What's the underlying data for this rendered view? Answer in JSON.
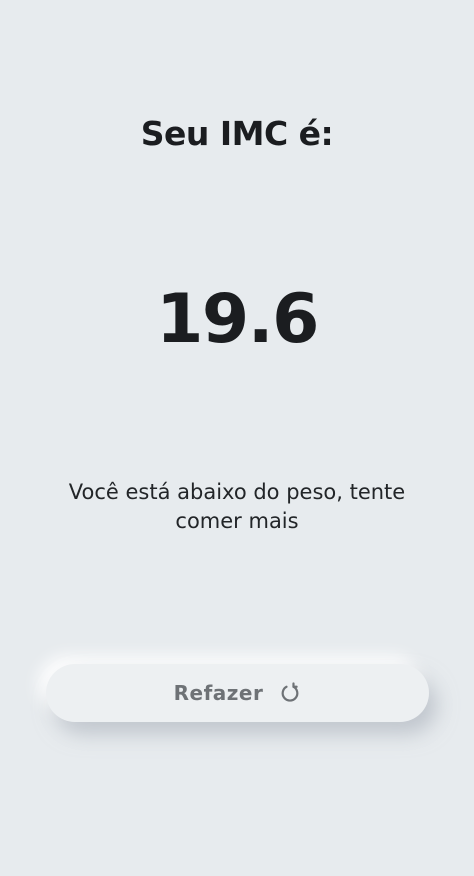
{
  "result": {
    "title": "Seu IMC é:",
    "value": "19.6",
    "message": "Você está abaixo do peso, tente comer mais"
  },
  "actions": {
    "redo_label": "Refazer",
    "redo_icon": "refresh-icon"
  },
  "colors": {
    "background": "#e7ebee",
    "button_background": "#edf0f2",
    "text": "#1b1d20",
    "button_text": "#6e7276"
  }
}
